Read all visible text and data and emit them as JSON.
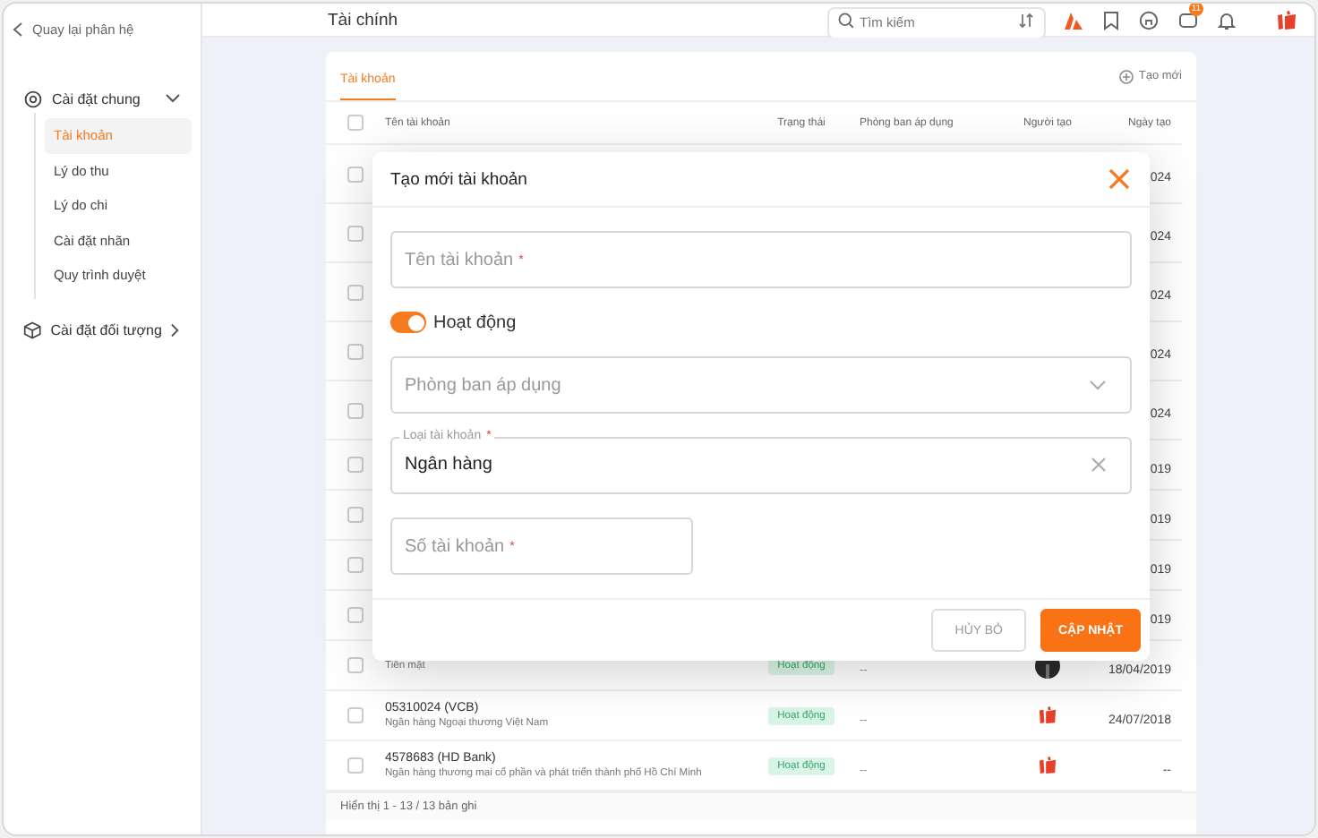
{
  "sidebar": {
    "back_link": "Quay lại phân hệ",
    "groups": [
      {
        "label": "Cài đặt chung",
        "expanded": true,
        "children": [
          {
            "label": "Tài khoản",
            "selected": true
          },
          {
            "label": "Lý do thu",
            "selected": false
          },
          {
            "label": "Lý do chi",
            "selected": false
          },
          {
            "label": "Cài đặt nhãn",
            "selected": false
          },
          {
            "label": "Quy trình duyệt",
            "selected": false
          }
        ]
      },
      {
        "label": "Cài đặt đối tượng",
        "expanded": false
      }
    ]
  },
  "topbar": {
    "title": "Tài chính",
    "search": {
      "placeholder": "Tìm kiếm"
    },
    "chat_badge": "11"
  },
  "card": {
    "tabs": [
      {
        "label": "Tài khoản",
        "selected": true
      }
    ],
    "new_button": "Tạo mới",
    "select_all_checked": false,
    "columns": [
      "Tên tài khoản",
      "Trạng thái",
      "Phòng ban áp dụng",
      "Người tạo",
      "Ngày tạo"
    ],
    "rows": [
      {
        "checked": false,
        "date": "024"
      },
      {
        "checked": false,
        "date": "024"
      },
      {
        "checked": false,
        "date": "024"
      },
      {
        "checked": false,
        "date": "024"
      },
      {
        "checked": false,
        "date": "024"
      },
      {
        "checked": false,
        "date": "019"
      },
      {
        "checked": false,
        "date": "019"
      },
      {
        "checked": false,
        "date": "019"
      },
      {
        "checked": false,
        "date": "019"
      },
      {
        "checked": false,
        "subtitle": "Tiền mặt",
        "status": "Hoạt động",
        "department": "--",
        "creator": {
          "kind": "photo"
        },
        "date": "18/04/2019"
      },
      {
        "checked": false,
        "name": "05310024 (VCB)",
        "subtitle": "Ngân hàng Ngoại thương Việt Nam",
        "status": "Hoạt động",
        "department": "--",
        "creator": {
          "kind": "logo"
        },
        "date": "24/07/2018"
      },
      {
        "checked": false,
        "name": "4578683 (HD Bank)",
        "subtitle": "Ngân hàng thương mại cổ phần và phát triển thành phố Hồ Chí Minh",
        "status": "Hoạt động",
        "department": "--",
        "creator": {
          "kind": "logo"
        },
        "date": "--"
      }
    ],
    "footer": "Hiển thị 1 - 13 / 13 bản ghi"
  },
  "modal": {
    "title": "Tạo mới tài khoản",
    "fields": [
      {
        "kind": "text",
        "placeholder": "Tên tài khoản",
        "required_mark": "*"
      },
      {
        "kind": "switch",
        "label": "Hoạt động",
        "on": true
      },
      {
        "kind": "select",
        "placeholder": "Phòng ban áp dụng"
      },
      {
        "kind": "select_filled",
        "label": "Loại tài khoản",
        "required_mark": "*",
        "value": "Ngân hàng"
      },
      {
        "kind": "text_short",
        "placeholder": "Số tài khoản",
        "required_mark": "*"
      }
    ],
    "buttons": [
      {
        "label": "HỦY BỎ",
        "kind": "secondary"
      },
      {
        "label": "CẬP NHẬT",
        "kind": "primary"
      }
    ]
  }
}
